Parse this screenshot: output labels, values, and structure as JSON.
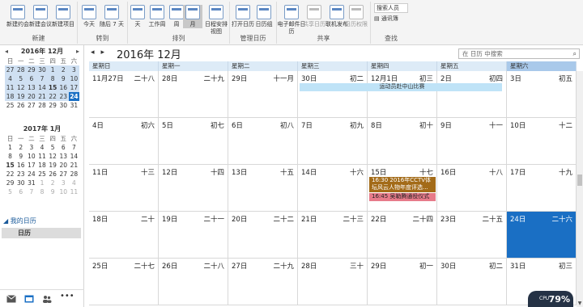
{
  "ribbon": {
    "groups": [
      {
        "label": "新建",
        "buttons": [
          "新建约会",
          "新建会议",
          "新建项目"
        ]
      },
      {
        "label": "转到",
        "buttons": [
          "今天",
          "随后 7 天"
        ]
      },
      {
        "label": "排列",
        "buttons": [
          "天",
          "工作周",
          "周",
          "月",
          "日程安排视图"
        ]
      },
      {
        "label": "管理日历",
        "buttons": [
          "打开日历",
          "日历组"
        ]
      },
      {
        "label": "共享",
        "buttons": [
          "电子邮件日历",
          "共享日历",
          "联机发布",
          "日历权限"
        ]
      },
      {
        "label": "查找",
        "search_people": "搜索人员",
        "address_book": "通讯簿"
      }
    ]
  },
  "mini_calendars": [
    {
      "title": "2016年 12月",
      "weekdays": [
        "日",
        "一",
        "二",
        "三",
        "四",
        "五",
        "六"
      ],
      "rows": [
        [
          "27",
          "28",
          "29",
          "30",
          "1",
          "2",
          "3"
        ],
        [
          "4",
          "5",
          "6",
          "7",
          "8",
          "9",
          "10"
        ],
        [
          "11",
          "12",
          "13",
          "14",
          "15",
          "16",
          "17"
        ],
        [
          "18",
          "19",
          "20",
          "21",
          "22",
          "23",
          "24"
        ],
        [
          "25",
          "26",
          "27",
          "28",
          "29",
          "30",
          "31"
        ]
      ]
    },
    {
      "title": "2017年 1月",
      "weekdays": [
        "日",
        "一",
        "二",
        "三",
        "四",
        "五",
        "六"
      ],
      "rows": [
        [
          "1",
          "2",
          "3",
          "4",
          "5",
          "6",
          "7"
        ],
        [
          "8",
          "9",
          "10",
          "11",
          "12",
          "13",
          "14"
        ],
        [
          "15",
          "16",
          "17",
          "18",
          "19",
          "20",
          "21"
        ],
        [
          "22",
          "23",
          "24",
          "25",
          "26",
          "27",
          "28"
        ],
        [
          "29",
          "30",
          "31",
          "1",
          "2",
          "3",
          "4"
        ],
        [
          "5",
          "6",
          "7",
          "8",
          "9",
          "10",
          "11"
        ]
      ]
    }
  ],
  "my_calendars": {
    "heading": "我的日历",
    "items": [
      "日历"
    ]
  },
  "main": {
    "month_title": "2016年 12月",
    "search_placeholder": "在 日历 中搜索",
    "weekdays": [
      "星期日",
      "星期一",
      "星期二",
      "星期三",
      "星期四",
      "星期五",
      "星期六"
    ],
    "weeks": [
      [
        [
          "11月27日",
          "二十八"
        ],
        [
          "28日",
          "二十九"
        ],
        [
          "29日",
          "十一月"
        ],
        [
          "30日",
          "初二"
        ],
        [
          "12月1日",
          "初三"
        ],
        [
          "2日",
          "初四"
        ],
        [
          "3日",
          "初五"
        ]
      ],
      [
        [
          "4日",
          "初六"
        ],
        [
          "5日",
          "初七"
        ],
        [
          "6日",
          "初八"
        ],
        [
          "7日",
          "初九"
        ],
        [
          "8日",
          "初十"
        ],
        [
          "9日",
          "十一"
        ],
        [
          "10日",
          "十二"
        ]
      ],
      [
        [
          "11日",
          "十三"
        ],
        [
          "12日",
          "十四"
        ],
        [
          "13日",
          "十五"
        ],
        [
          "14日",
          "十六"
        ],
        [
          "15日",
          "十七"
        ],
        [
          "16日",
          "十八"
        ],
        [
          "17日",
          "十九"
        ]
      ],
      [
        [
          "18日",
          "二十"
        ],
        [
          "19日",
          "二十一"
        ],
        [
          "20日",
          "二十二"
        ],
        [
          "21日",
          "二十三"
        ],
        [
          "22日",
          "二十四"
        ],
        [
          "23日",
          "二十五"
        ],
        [
          "24日",
          "二十六"
        ]
      ],
      [
        [
          "25日",
          "二十七"
        ],
        [
          "26日",
          "二十八"
        ],
        [
          "27日",
          "二十九"
        ],
        [
          "28日",
          "三十"
        ],
        [
          "29日",
          "初一"
        ],
        [
          "30日",
          "初二"
        ],
        [
          "31日",
          "初三"
        ]
      ]
    ],
    "events": {
      "sports_meet": "运动员赴中山比赛",
      "cctv_event": "16:30 2016年CCTV体坛风云人物年度评选...",
      "deposit_event": "16:45 吴勒腾通役仪式"
    }
  },
  "system_badge": {
    "label": "CPU",
    "percent": "79%"
  },
  "colors": {
    "accent": "#1a6fc4",
    "week_header": "#ddebf7",
    "event_blue": "#bfe3f7",
    "event_brown": "#a36b18",
    "event_red": "#e77b8a"
  }
}
